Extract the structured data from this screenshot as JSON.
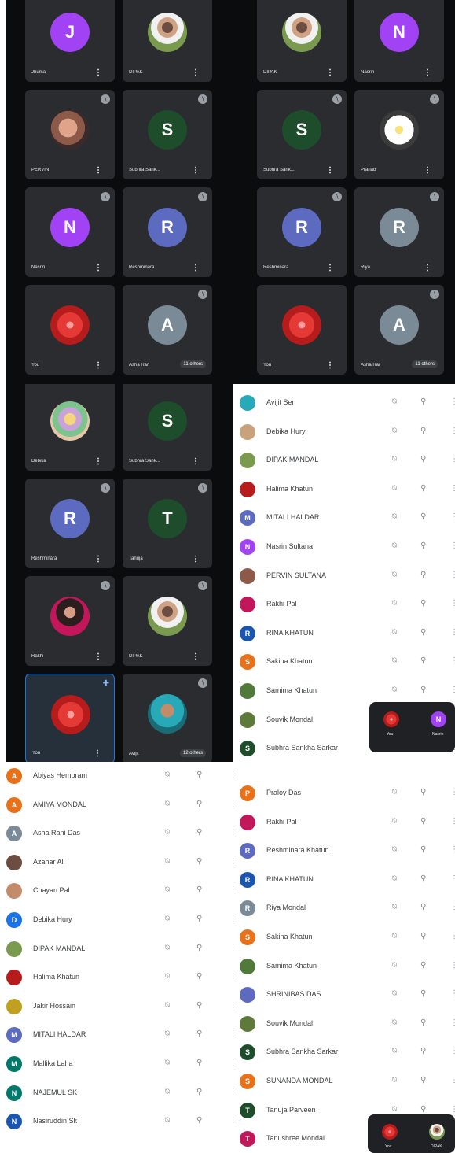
{
  "colors": {
    "purple": "#a142f4",
    "green_dark": "#1e4d2b",
    "blue_r": "#5c6bc0",
    "grey_a": "#7b8a97",
    "orange": "#e8711a",
    "navy": "#1a56b0"
  },
  "grid1": [
    {
      "label": "Jhuma",
      "letter": "J",
      "color": "#a142f4",
      "kind": "letter"
    },
    {
      "label": "DIPAK",
      "kind": "photo-man"
    },
    {
      "label": "PERVIN",
      "kind": "photo-hand",
      "mute": true
    },
    {
      "label": "Subhra Sank...",
      "letter": "S",
      "color": "#1e4d2b",
      "kind": "letter",
      "mute": true
    },
    {
      "label": "Nasrin",
      "letter": "N",
      "color": "#a142f4",
      "kind": "letter",
      "mute": true
    },
    {
      "label": "Reshminara",
      "letter": "R",
      "color": "#5c6bc0",
      "kind": "letter",
      "mute": true
    },
    {
      "label": "You",
      "kind": "photo-flower"
    },
    {
      "label": "Asha Rar",
      "letter": "A",
      "color": "#7b8a97",
      "kind": "letter",
      "mute": true,
      "others": "11 others"
    }
  ],
  "grid2": [
    {
      "label": "DIPAK",
      "kind": "photo-man"
    },
    {
      "label": "Nasrin",
      "letter": "N",
      "color": "#a142f4",
      "kind": "letter"
    },
    {
      "label": "Subhra Sank...",
      "letter": "S",
      "color": "#1e4d2b",
      "kind": "letter",
      "mute": true
    },
    {
      "label": "Pranab",
      "kind": "photo-daisy",
      "mute": true
    },
    {
      "label": "Reshminara",
      "letter": "R",
      "color": "#5c6bc0",
      "kind": "letter",
      "mute": true
    },
    {
      "label": "Riya",
      "letter": "R",
      "color": "#7b8a97",
      "kind": "letter",
      "mute": true
    },
    {
      "label": "You",
      "kind": "photo-flower"
    },
    {
      "label": "Asha Rar",
      "letter": "A",
      "color": "#7b8a97",
      "kind": "letter",
      "mute": true,
      "others": "11 others"
    }
  ],
  "grid3": [
    {
      "label": "Debika",
      "kind": "photo-painting"
    },
    {
      "label": "Subhra Sank...",
      "letter": "S",
      "color": "#1e4d2b",
      "kind": "letter"
    },
    {
      "label": "Reshminara",
      "letter": "R",
      "color": "#5c6bc0",
      "kind": "letter",
      "mute": true
    },
    {
      "label": "Tanuja",
      "letter": "T",
      "color": "#1e4d2b",
      "kind": "letter",
      "mute": true
    },
    {
      "label": "Rakhi",
      "kind": "photo-rakhi",
      "mute": true
    },
    {
      "label": "DIPAK",
      "kind": "photo-man",
      "mute": true
    },
    {
      "label": "You",
      "kind": "photo-flower",
      "active": true
    },
    {
      "label": "Avijit",
      "kind": "photo-avijit",
      "mute": true,
      "others": "12 others"
    }
  ],
  "list_top": [
    {
      "name": "Avijit Sen",
      "color": "#27a9b8"
    },
    {
      "name": "Debika Hury",
      "color": "#c8a27a"
    },
    {
      "name": "DIPAK MANDAL",
      "color": "#7a9b4f"
    },
    {
      "name": "Halima Khatun",
      "color": "#b71c1c"
    },
    {
      "name": "MITALI HALDAR",
      "letter": "M",
      "color": "#5c6bc0"
    },
    {
      "name": "Nasrin Sultana",
      "letter": "N",
      "color": "#a142f4"
    },
    {
      "name": "PERVIN SULTANA",
      "color": "#8d5a4a"
    },
    {
      "name": "Rakhi Pal",
      "color": "#c2185b"
    },
    {
      "name": "RINA KHATUN",
      "letter": "R",
      "color": "#1a56b0"
    },
    {
      "name": "Sakina Khatun",
      "letter": "S",
      "color": "#e8711a"
    },
    {
      "name": "Samima Khatun",
      "color": "#4f7a3a"
    },
    {
      "name": "Souvik Mondal",
      "color": "#5d7a3a"
    },
    {
      "name": "Subhra Sankha Sarkar",
      "letter": "S",
      "color": "#1e4d2b"
    }
  ],
  "list_left": [
    {
      "name": "Abiyas Hembram",
      "letter": "A",
      "color": "#e8711a"
    },
    {
      "name": "AMIYA MONDAL",
      "letter": "A",
      "color": "#e8711a"
    },
    {
      "name": "Asha Rani Das",
      "letter": "A",
      "color": "#7b8a97"
    },
    {
      "name": "Azahar Ali",
      "color": "#6d4c41"
    },
    {
      "name": "Chayan Pal",
      "color": "#c48b6b"
    },
    {
      "name": "Debika Hury",
      "letter": "D",
      "color": "#1a73e8"
    },
    {
      "name": "DIPAK MANDAL",
      "color": "#7a9b4f"
    },
    {
      "name": "Halima Khatun",
      "color": "#b71c1c"
    },
    {
      "name": "Jakir Hossain",
      "color": "#c0a020"
    },
    {
      "name": "MITALI HALDAR",
      "letter": "M",
      "color": "#5c6bc0"
    },
    {
      "name": "Mallika Laha",
      "letter": "M",
      "color": "#00796b"
    },
    {
      "name": "NAJEMUL SK",
      "letter": "N",
      "color": "#00796b"
    },
    {
      "name": "Nasiruddin Sk",
      "letter": "N",
      "color": "#1a56b0"
    }
  ],
  "list_right": [
    {
      "name": "Praloy Das",
      "letter": "P",
      "color": "#e8711a"
    },
    {
      "name": "Rakhi Pal",
      "color": "#c2185b"
    },
    {
      "name": "Reshminara Khatun",
      "letter": "R",
      "color": "#5c6bc0"
    },
    {
      "name": "RINA KHATUN",
      "letter": "R",
      "color": "#1a56b0"
    },
    {
      "name": "Riya Mondal",
      "letter": "R",
      "color": "#7b8a97"
    },
    {
      "name": "Sakina Khatun",
      "letter": "S",
      "color": "#e8711a"
    },
    {
      "name": "Samima Khatun",
      "color": "#4f7a3a"
    },
    {
      "name": "SHRINIBAS DAS",
      "color": "#5c6bc0"
    },
    {
      "name": "Souvik Mondal",
      "color": "#5d7a3a"
    },
    {
      "name": "Subhra Sankha Sarkar",
      "letter": "S",
      "color": "#1e4d2b"
    },
    {
      "name": "SUNANDA MONDAL",
      "letter": "S",
      "color": "#e8711a"
    },
    {
      "name": "Tanuja Parveen",
      "letter": "T",
      "color": "#1e4d2b"
    },
    {
      "name": "Tanushree Mondal",
      "letter": "T",
      "color": "#c2185b"
    }
  ],
  "mini1": {
    "a": "You",
    "b": "Nasrin",
    "b_letter": "N"
  },
  "mini2": {
    "a": "You",
    "b": "DIPAK"
  },
  "icons": {
    "mute": "mic-off-icon",
    "pin": "pin-icon",
    "more": "more-vert-icon"
  }
}
